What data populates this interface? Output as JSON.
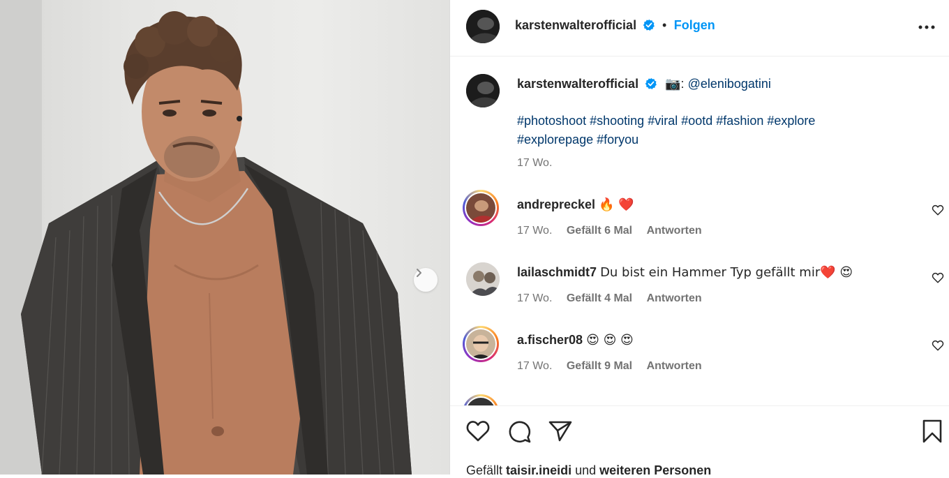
{
  "post": {
    "author": "karstenwalterofficial",
    "follow_label": "Folgen",
    "separator": "•",
    "caption": {
      "author": "karstenwalterofficial",
      "camera_emoji": "📷",
      "colon": ":",
      "mention": "@elenibogatini",
      "hashtags_line1": [
        "#photoshoot",
        "#shooting",
        "#viral",
        "#ootd",
        "#fashion",
        "#explore"
      ],
      "hashtags_line2": [
        "#explorepage",
        "#foryou"
      ],
      "age": "17 Wo."
    }
  },
  "comments": [
    {
      "user": "andrepreckel",
      "text": "🔥 ❤️",
      "age": "17 Wo.",
      "likes": "Gefällt 6 Mal",
      "reply": "Antworten",
      "story_ring": true
    },
    {
      "user": "lailaschmidt7",
      "text": "Du bist ein Hammer Typ gefällt mir❤️ 😍",
      "age": "17 Wo.",
      "likes": "Gefällt 4 Mal",
      "reply": "Antworten",
      "story_ring": false
    },
    {
      "user": "a.fischer08",
      "text": "😍 😍 😍",
      "age": "17 Wo.",
      "likes": "Gefällt 9 Mal",
      "reply": "Antworten",
      "story_ring": true
    }
  ],
  "footer": {
    "likes_prefix": "Gefällt",
    "likes_user": "taisir.ineidi",
    "likes_and": "und",
    "likes_others": "weiteren Personen"
  },
  "icons": {
    "verified": "verified-badge-icon",
    "more": "more-options-icon",
    "next": "chevron-right-icon",
    "like": "heart-icon",
    "comment": "comment-icon",
    "share": "share-icon",
    "save": "bookmark-icon"
  },
  "colors": {
    "accent": "#0095f6",
    "link": "#00376b",
    "muted": "#737373",
    "text": "#262626",
    "verified": "#0095f6"
  }
}
